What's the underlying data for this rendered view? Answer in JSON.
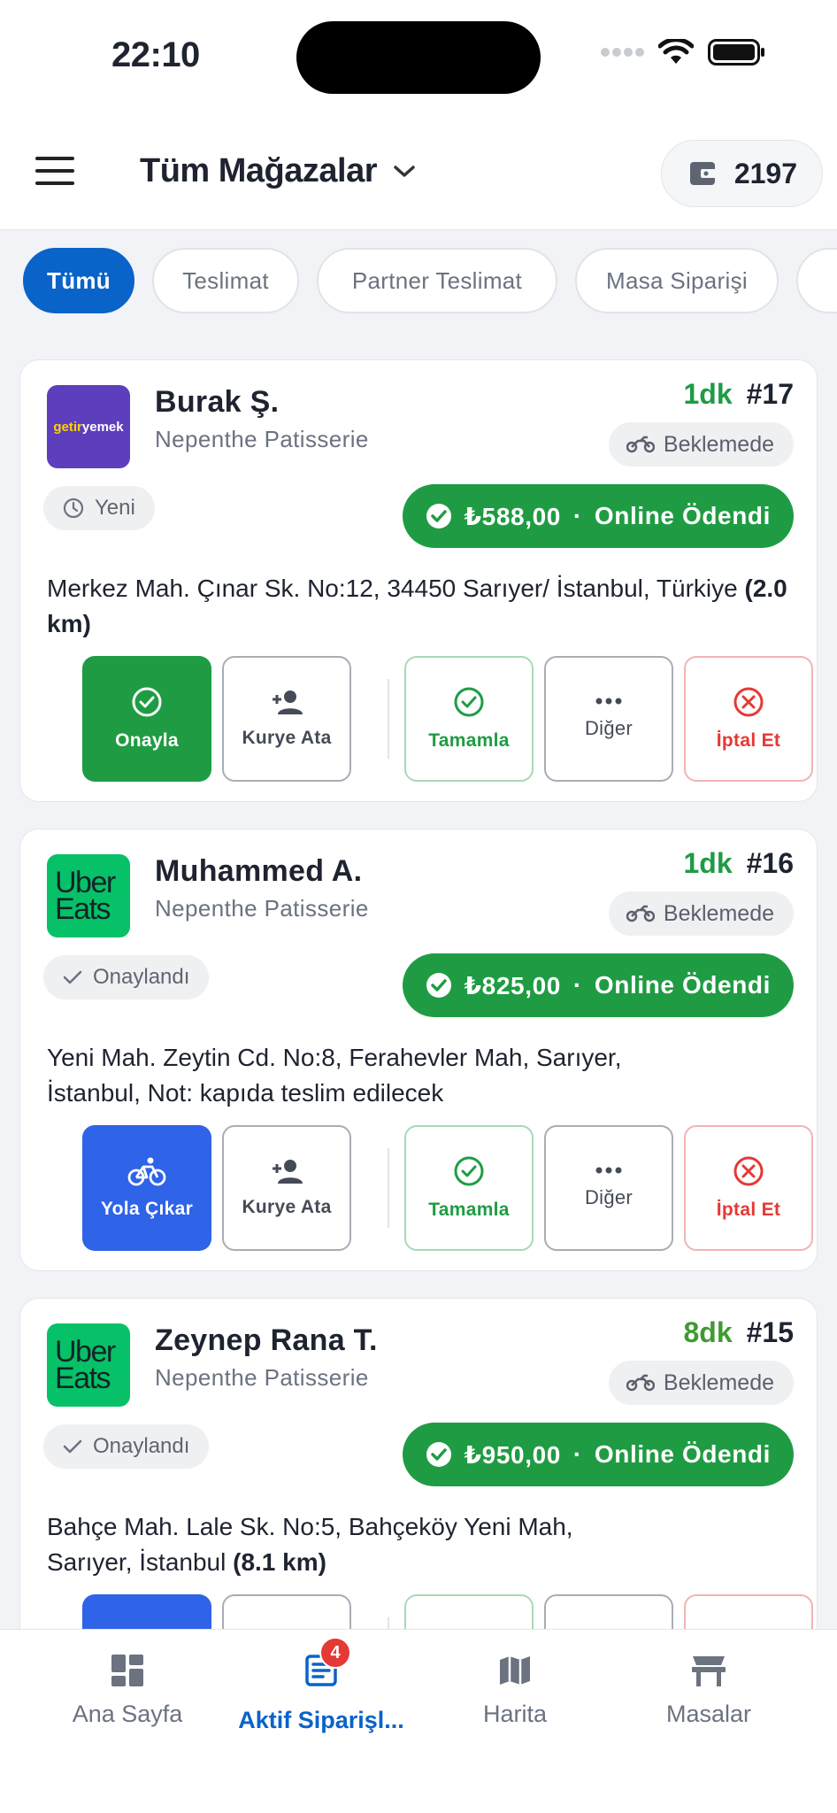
{
  "status_bar": {
    "time": "22:10"
  },
  "header": {
    "store_select_label": "Tüm Mağazalar",
    "wallet_value": "2197"
  },
  "filters": [
    "Tümü",
    "Teslimat",
    "Partner Teslimat",
    "Masa Siparişi"
  ],
  "orders": [
    {
      "platform": "getiryemek",
      "logo_text_1": "getir",
      "logo_text_2": "yemek",
      "customer": "Burak Ş.",
      "store": "Nepenthe Patisserie",
      "minutes": "1dk",
      "order_no": "#17",
      "delivery_status": "Beklemede",
      "state": "Yeni",
      "amount": "₺588,00",
      "separator": "·",
      "payment": "Online Ödendi",
      "address": "Merkez Mah. Çınar Sk. No:12, 34450 Sarıyer/ İstanbul, Türkiye",
      "distance": "(2.0 km)",
      "actions": [
        "Onayla",
        "Kurye Ata",
        "Tamamla",
        "Diğer",
        "İptal Et"
      ]
    },
    {
      "platform": "ubereats",
      "logo_text_1": "Uber",
      "logo_text_2": "Eats",
      "customer": "Muhammed A.",
      "store": "Nepenthe Patisserie",
      "minutes": "1dk",
      "order_no": "#16",
      "delivery_status": "Beklemede",
      "state": "Onaylandı",
      "amount": "₺825,00",
      "separator": "·",
      "payment": "Online Ödendi",
      "address": "Yeni Mah. Zeytin Cd. No:8, Ferahevler Mah, Sarıyer, İstanbul, Not: kapıda teslim edilecek",
      "distance": "",
      "actions": [
        "Yola Çıkar",
        "Kurye Ata",
        "Tamamla",
        "Diğer",
        "İptal Et"
      ]
    },
    {
      "platform": "ubereats",
      "logo_text_1": "Uber",
      "logo_text_2": "Eats",
      "customer": "Zeynep Rana T.",
      "store": "Nepenthe Patisserie",
      "minutes": "8dk",
      "order_no": "#15",
      "delivery_status": "Beklemede",
      "state": "Onaylandı",
      "amount": "₺950,00",
      "separator": "·",
      "payment": "Online Ödendi",
      "address": "Bahçe Mah. Lale Sk. No:5, Bahçeköy Yeni Mah, Sarıyer, İstanbul",
      "distance": "(8.1 km)"
    }
  ],
  "bottom_nav": [
    {
      "label": "Ana Sayfa",
      "icon": "dashboard-icon"
    },
    {
      "label": "Aktif Siparişl...",
      "icon": "orders-icon",
      "badge": "4"
    },
    {
      "label": "Harita",
      "icon": "map-icon"
    },
    {
      "label": "Masalar",
      "icon": "table-icon"
    }
  ],
  "colors": {
    "primary_blue": "#0a63c9",
    "success_green": "#1f9c43",
    "danger_red": "#e53935",
    "route_blue": "#2f63e8"
  }
}
